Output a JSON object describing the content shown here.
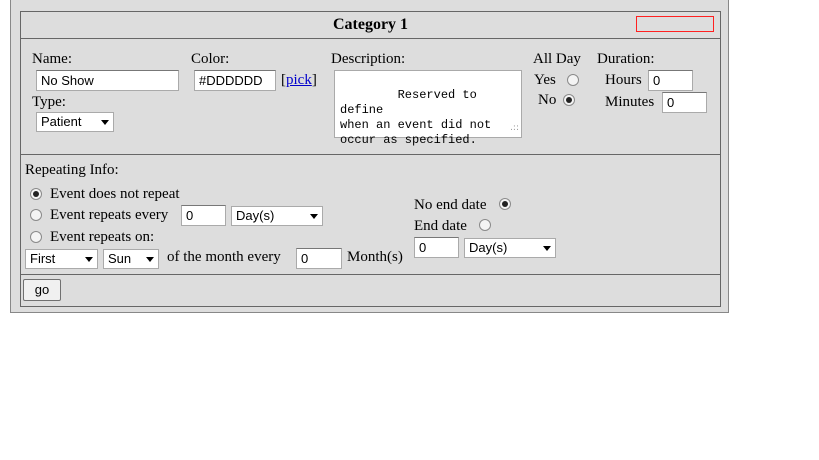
{
  "category": {
    "title": "Category 1",
    "color_swatch": "#DDDDDD"
  },
  "fields": {
    "name_label": "Name:",
    "name_value": "No Show",
    "type_label": "Type:",
    "type_value": "Patient",
    "color_label": "Color:",
    "color_value": "#DDDDDD",
    "pick_open": "[",
    "pick_link": "pick",
    "pick_close": "]",
    "description_label": "Description:",
    "description_value": "Reserved to define\nwhen an event did not\noccur as specified.",
    "allday_label": "All Day",
    "allday_yes": "Yes",
    "allday_no": "No",
    "allday_selected": "No",
    "duration_label": "Duration:",
    "hours_label": "Hours",
    "hours_value": "0",
    "minutes_label": "Minutes",
    "minutes_value": "0"
  },
  "repeat": {
    "heading": "Repeating Info:",
    "option_no_repeat": "Event does not repeat",
    "option_every": "Event repeats every",
    "every_value": "0",
    "every_unit": "Day(s)",
    "option_on": "Event repeats on:",
    "on_ordinal": "First",
    "on_day": "Sun",
    "of_month_every": "of the month every",
    "month_value": "0",
    "month_unit": "Month(s)",
    "selected": "Event does not repeat",
    "no_end_label": "No end date",
    "end_date_label": "End date",
    "end_selected": "No end date",
    "end_value": "0",
    "end_unit": "Day(s)"
  },
  "actions": {
    "go_label": "go"
  }
}
